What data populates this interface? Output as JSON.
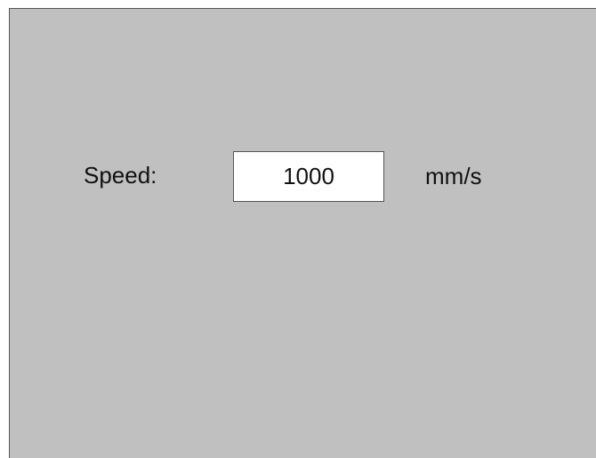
{
  "speed_setting": {
    "label": "Speed:",
    "value": "1000",
    "unit": "mm/s"
  },
  "colors": {
    "panel_background": "#c0c0c0",
    "field_background": "#ffffff",
    "border": "#555555",
    "text": "#111111"
  }
}
